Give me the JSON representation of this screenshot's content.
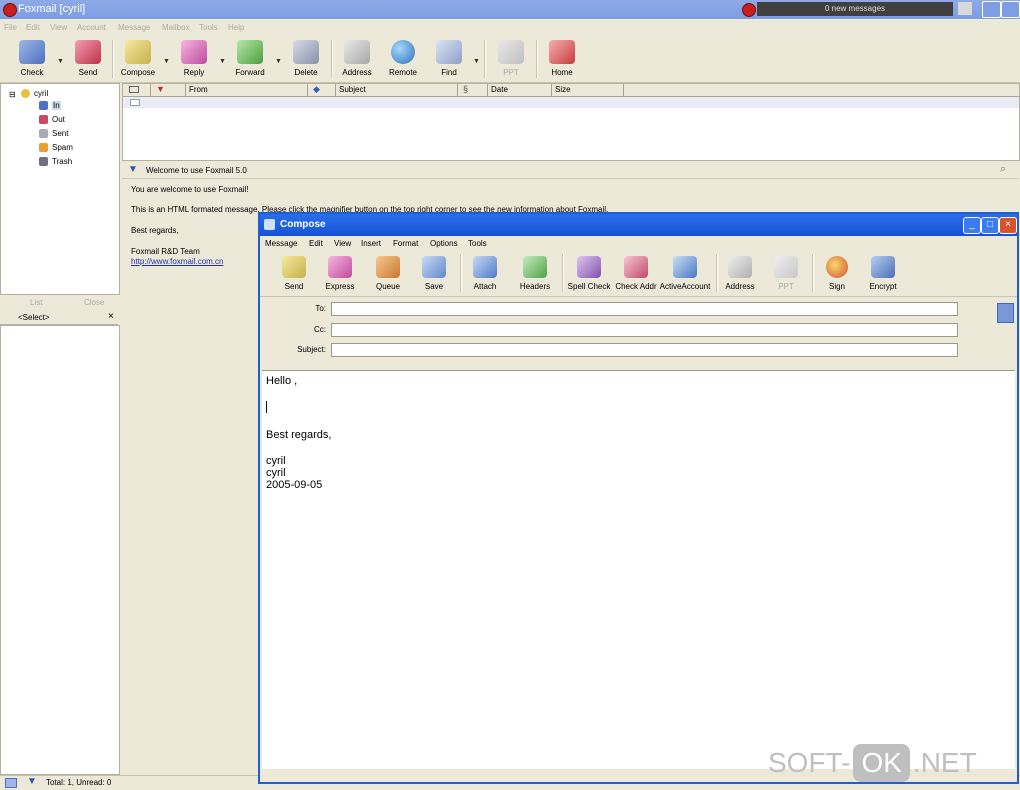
{
  "app": {
    "title": "Foxmail [cyril]",
    "new_messages": "0 new messages",
    "colors": {
      "titlebar": "#7c9ee2",
      "compose_titlebar": "#1553d8",
      "background": "#ece9d8"
    }
  },
  "menu": [
    "File",
    "Edit",
    "View",
    "Account",
    "Message",
    "Mailbox",
    "Tools",
    "Help"
  ],
  "toolbar": [
    {
      "label": "Check",
      "icon": "check-mail-icon"
    },
    {
      "label": "Send",
      "icon": "send-icon"
    },
    {
      "label": "Compose",
      "icon": "compose-icon"
    },
    {
      "label": "Reply",
      "icon": "reply-icon"
    },
    {
      "label": "Forward",
      "icon": "forward-icon"
    },
    {
      "label": "Delete",
      "icon": "delete-icon"
    },
    {
      "label": "Address",
      "icon": "address-book-icon"
    },
    {
      "label": "Remote",
      "icon": "globe-icon"
    },
    {
      "label": "Find",
      "icon": "find-icon"
    },
    {
      "label": "PPT",
      "icon": "ppt-icon"
    },
    {
      "label": "Home",
      "icon": "home-icon"
    }
  ],
  "folders": {
    "account": "cyril",
    "items": [
      "In",
      "Out",
      "Sent",
      "Spam",
      "Trash"
    ]
  },
  "lower_left": {
    "tab_left": "List",
    "tab_right": "Close",
    "select": "<Select>"
  },
  "message_list": {
    "columns": [
      "From",
      "Subject",
      "Date",
      "Size"
    ]
  },
  "preview": {
    "header": "Welcome to use Foxmail 5.0",
    "lines": [
      "You are welcome to use Foxmail!",
      "This is an HTML formated message. Please click the magnifier button on the top right corner to see the new information about Foxmail.",
      "Best regards,",
      "Foxmail R&D Team",
      "http://www.foxmail.com.cn"
    ]
  },
  "status": {
    "text": "Total: 1, Unread: 0"
  },
  "compose": {
    "title": "Compose",
    "menu": [
      "Message",
      "Edit",
      "View",
      "Insert",
      "Format",
      "Options",
      "Tools"
    ],
    "toolbar": [
      {
        "label": "Send",
        "icon": "send-icon"
      },
      {
        "label": "Express",
        "icon": "express-icon"
      },
      {
        "label": "Queue",
        "icon": "queue-icon"
      },
      {
        "label": "Save",
        "icon": "save-icon"
      },
      {
        "label": "Attach",
        "icon": "paperclip-icon"
      },
      {
        "label": "Headers",
        "icon": "headers-icon"
      },
      {
        "label": "Spell Check",
        "icon": "spell-check-icon"
      },
      {
        "label": "Check Addr",
        "icon": "check-addr-icon"
      },
      {
        "label": "ActiveAccount",
        "icon": "active-account-icon"
      },
      {
        "label": "Address",
        "icon": "address-book-icon"
      },
      {
        "label": "PPT",
        "icon": "ppt-icon"
      },
      {
        "label": "Sign",
        "icon": "sign-icon"
      },
      {
        "label": "Encrypt",
        "icon": "encrypt-icon"
      }
    ],
    "fields": {
      "to_label": "To:",
      "cc_label": "Cc:",
      "subject_label": "Subject:",
      "to": "",
      "cc": "",
      "subject": ""
    },
    "body": [
      "Hello ,",
      "Best regards,",
      "cyril",
      "cyril",
      "2005-09-05"
    ]
  },
  "watermark": {
    "left": "SOFT-",
    "ok": "OK",
    "right": ".NET"
  }
}
